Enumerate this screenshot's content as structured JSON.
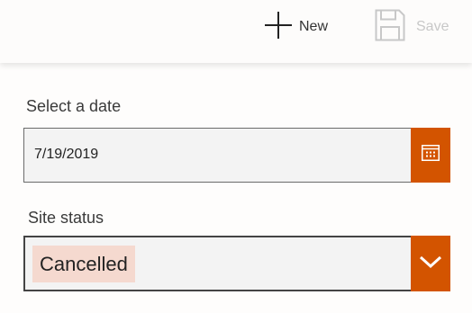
{
  "toolbar": {
    "new_label": "New",
    "save_label": "Save",
    "new_icon": "plus-icon",
    "save_icon": "save-icon",
    "save_disabled": true
  },
  "form": {
    "date_label": "Select a date",
    "date_value": "7/19/2019",
    "calendar_icon": "calendar-icon",
    "status_label": "Site status",
    "status_value": "Cancelled",
    "dropdown_icon": "chevron-down-icon"
  },
  "colors": {
    "accent": "#d35400",
    "chip_background": "#f5d9cf",
    "disabled_text": "#c8c8c8"
  }
}
